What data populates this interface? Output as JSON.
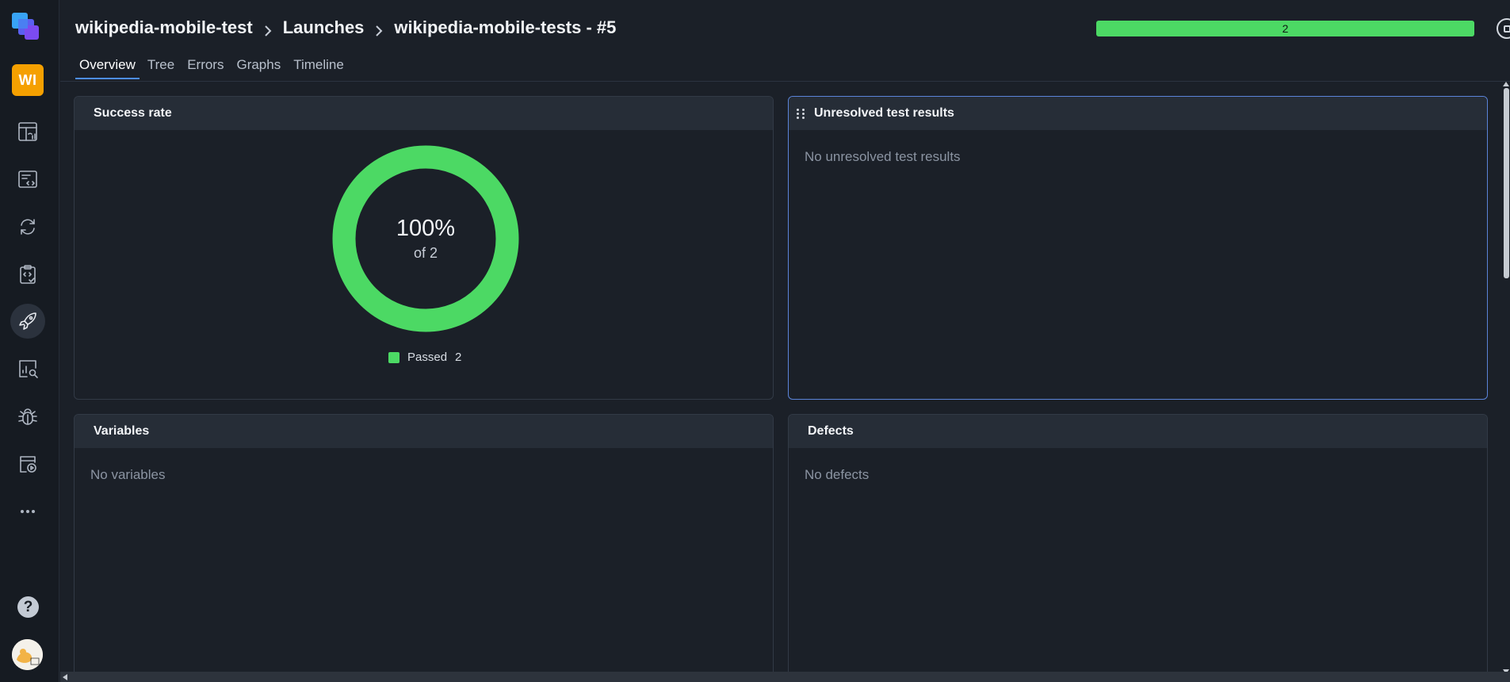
{
  "sidebar": {
    "project_badge": "WI",
    "items": [
      {
        "name": "dashboards-icon"
      },
      {
        "name": "test-cases-icon"
      },
      {
        "name": "sync-icon"
      },
      {
        "name": "test-plans-icon"
      },
      {
        "name": "launches-icon",
        "active": true
      },
      {
        "name": "analytics-icon"
      },
      {
        "name": "defects-icon"
      },
      {
        "name": "jobs-icon"
      },
      {
        "name": "more-icon"
      }
    ],
    "help_label": "?"
  },
  "header": {
    "breadcrumb": [
      "wikipedia-mobile-test",
      "Launches",
      "wikipedia-mobile-tests - #5"
    ],
    "tabs": [
      "Overview",
      "Tree",
      "Errors",
      "Graphs",
      "Timeline"
    ],
    "active_tab": "Overview",
    "progress_label": "2",
    "progress_fraction": 1.0
  },
  "panels": {
    "success_rate": {
      "title": "Success rate",
      "percent_label": "100%",
      "of_label": "of 2",
      "legend_label": "Passed",
      "legend_count": "2"
    },
    "unresolved": {
      "title": "Unresolved test results",
      "empty_text": "No unresolved test results"
    },
    "variables": {
      "title": "Variables",
      "empty_text": "No variables"
    },
    "defects": {
      "title": "Defects",
      "empty_text": "No defects"
    }
  },
  "chart_data": {
    "type": "pie",
    "categories": [
      "Passed"
    ],
    "values": [
      2
    ],
    "colors": [
      "#4cd964"
    ]
  },
  "colors": {
    "passed": "#4cd964",
    "accent": "#4d8ef7",
    "project_badge": "#f5a000"
  }
}
